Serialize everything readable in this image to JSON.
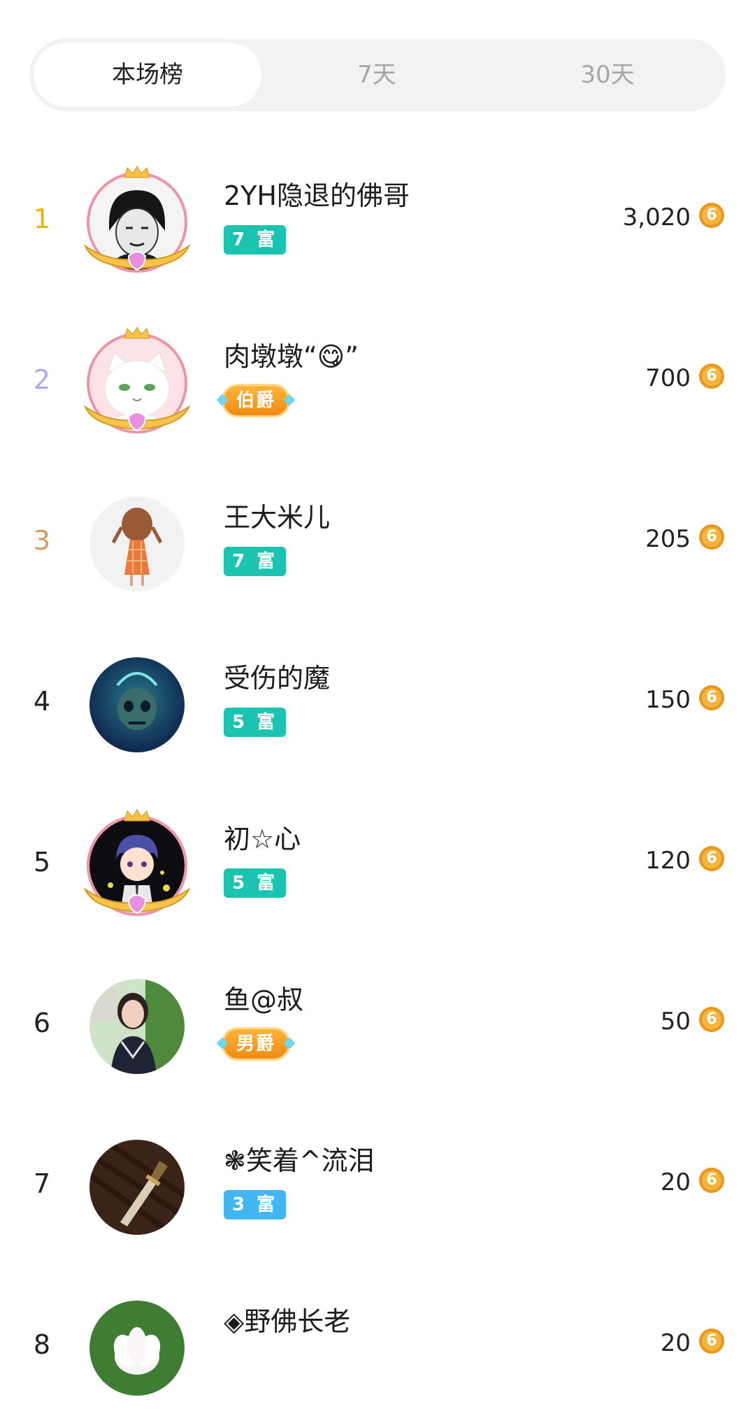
{
  "tabs": {
    "items": [
      {
        "label": "本场榜",
        "active": true
      },
      {
        "label": "7天",
        "active": false
      },
      {
        "label": "30天",
        "active": false
      }
    ]
  },
  "leaderboard": {
    "coin_symbol": "6",
    "coin_color": "#f5b43c",
    "rows": [
      {
        "rank": "1",
        "rank_color": "#f0b400",
        "name": "2YH隐退的佛哥",
        "badge": "7 富",
        "badge_style": "teal",
        "score": "3,020",
        "avatar_icon": "meme-face-avatar",
        "frame": true
      },
      {
        "rank": "2",
        "rank_color": "#b0a8f0",
        "name": "肉墩墩“😋”",
        "badge": "伯爵",
        "badge_style": "gold",
        "score": "700",
        "avatar_icon": "white-cat-avatar",
        "frame": true
      },
      {
        "rank": "3",
        "rank_color": "#d89a5a",
        "name": "王大米儿",
        "badge": "7 富",
        "badge_style": "teal",
        "score": "205",
        "avatar_icon": "girl-cartoon-avatar",
        "frame": false
      },
      {
        "rank": "4",
        "rank_color": "#222222",
        "name": "受伤的魔",
        "badge": "5 富",
        "badge_style": "teal",
        "score": "150",
        "avatar_icon": "skull-avatar",
        "frame": false
      },
      {
        "rank": "5",
        "rank_color": "#222222",
        "name": "初☆心",
        "badge": "5 富",
        "badge_style": "teal",
        "score": "120",
        "avatar_icon": "anime-boy-avatar",
        "frame": true
      },
      {
        "rank": "6",
        "rank_color": "#222222",
        "name": "鱼@叔",
        "badge": "男爵",
        "badge_style": "gold",
        "score": "50",
        "avatar_icon": "woman-photo-avatar",
        "frame": false
      },
      {
        "rank": "7",
        "rank_color": "#222222",
        "name": "❃笑着^流泪",
        "badge": "3 富",
        "badge_style": "blue",
        "score": "20",
        "avatar_icon": "dagger-avatar",
        "frame": false
      },
      {
        "rank": "8",
        "rank_color": "#222222",
        "name": "◈野佛长老",
        "badge": "",
        "badge_style": "teal",
        "score": "20",
        "avatar_icon": "lotus-avatar",
        "frame": false
      }
    ]
  }
}
